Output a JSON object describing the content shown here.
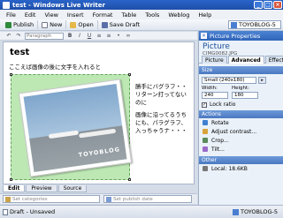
{
  "window": {
    "title": "test - Windows Live Writer"
  },
  "menu": [
    "File",
    "Edit",
    "View",
    "Insert",
    "Format",
    "Table",
    "Tools",
    "Weblog",
    "Help"
  ],
  "toolbar": {
    "publish": "Publish",
    "new": "New",
    "open": "Open",
    "save_draft": "Save Draft",
    "blog": "TOYOBLOG-5"
  },
  "format_toolbar": {
    "style_value": "Paragraph"
  },
  "editor": {
    "post_title": "test",
    "paragraph1": "ここえば画像の後に文字を入れると",
    "watermark": "TOYOBLOG",
    "wrap_lines": [
      "勝手にバグラフ・・リターン打ってないのに",
      "画像に沿ってるうちにも、パラグラフ、入っちゃうナ・・・"
    ]
  },
  "edit_tabs": [
    "Edit",
    "Preview",
    "Source"
  ],
  "bottom": {
    "categories_placeholder": "Set categories",
    "date_placeholder": "Set publish date"
  },
  "status": {
    "left": "Draft - Unsaved",
    "right": "TOYOBLOG-5"
  },
  "sidebar": {
    "header": "Picture Properties",
    "picture_label": "Picture",
    "filename": "CIMG0082.JPG",
    "tabs": [
      "Picture",
      "Advanced",
      "Effects"
    ],
    "size_section": "Size",
    "size_value": "Small (240x180)",
    "width_label": "Width:",
    "height_label": "Height:",
    "width_value": "240",
    "height_value": "180",
    "lock_label": "Lock ratio",
    "actions_section": "Actions",
    "actions": [
      "Rotate",
      "Adjust contrast...",
      "Crop...",
      "Tilt..."
    ],
    "other_section": "Other",
    "local": "Local: 18.6KB"
  },
  "colors": {
    "titlebar": "#2a64c9",
    "photo_bg": "#bde8b4",
    "sidebar_head": "#2f63b8"
  }
}
